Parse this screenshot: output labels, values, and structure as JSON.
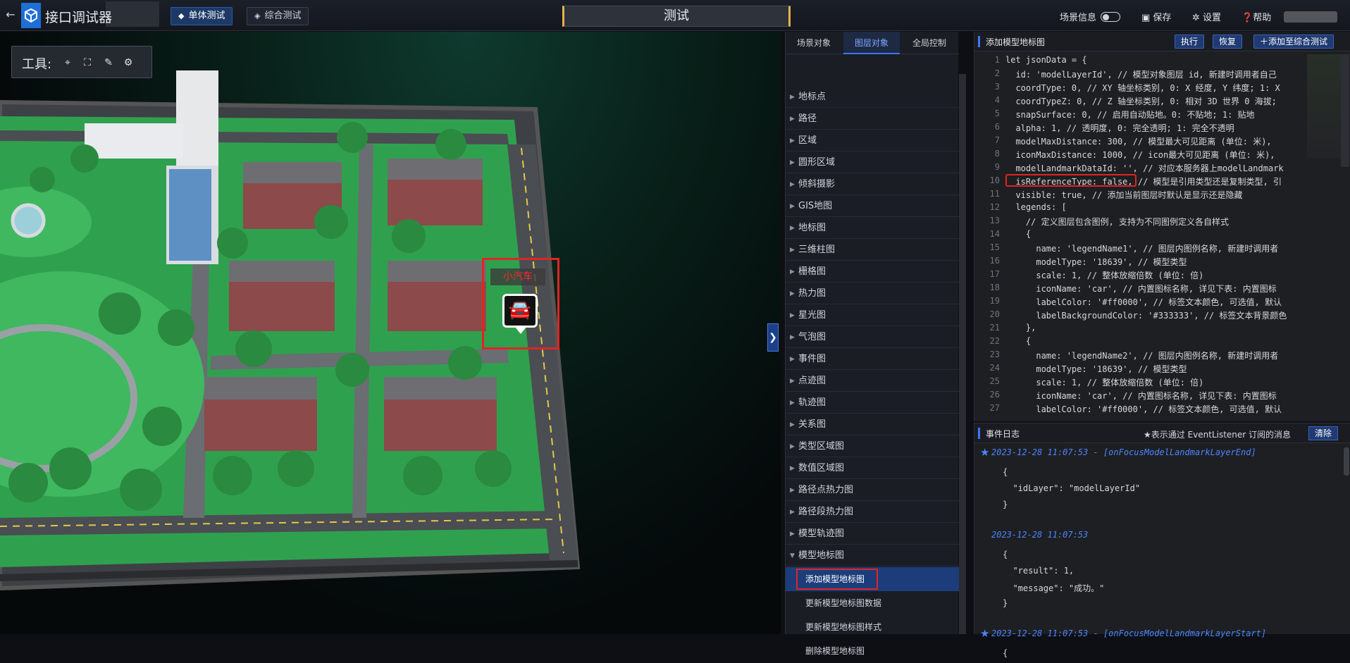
{
  "app": {
    "title": "接口调试器",
    "back_icon": "back-arrow-icon",
    "logo_icon": "cube-logo-icon"
  },
  "modes": {
    "single": "单体测试",
    "combined": "综合测试"
  },
  "center_title": "测试",
  "topright": {
    "scene_info": "场景信息",
    "save": "保存",
    "settings": "设置",
    "help": "帮助"
  },
  "toolbox": {
    "label": "工具:",
    "icons": [
      "location-pin-icon",
      "frame-select-icon",
      "pen-icon",
      "gear-multi-icon"
    ]
  },
  "scene": {
    "marker_label": "小汽车",
    "marker_icon": "car-icon"
  },
  "left_tabs": [
    "场景对象",
    "图层对象",
    "全局控制"
  ],
  "categories": [
    "地标点",
    "路径",
    "区域",
    "圆形区域",
    "倾斜摄影",
    "GIS地图",
    "地标图",
    "三维柱图",
    "栅格图",
    "热力图",
    "星光图",
    "气泡图",
    "事件图",
    "点迹图",
    "轨迹图",
    "关系图",
    "类型区域图",
    "数值区域图",
    "路径点热力图",
    "路径段热力图",
    "模型轨迹图",
    "模型地标图"
  ],
  "submenu": [
    "添加模型地标图",
    "更新模型地标图数据",
    "更新模型地标图样式",
    "删除模型地标图"
  ],
  "code_panel": {
    "title": "添加模型地标图",
    "run": "执行",
    "restore": "恢复",
    "add_to": "添加至综合测试"
  },
  "code_lines": [
    {
      "n": "1",
      "t": "let jsonData = {"
    },
    {
      "n": "2",
      "t": "  id: 'modelLayerId', // 模型对象图层 id, 新建时调用者自己"
    },
    {
      "n": "3",
      "t": "  coordType: 0, // XY 轴坐标类别, 0: X 经度, Y 纬度; 1: X"
    },
    {
      "n": "4",
      "t": "  coordTypeZ: 0, // Z 轴坐标类别, 0: 相对 3D 世界 0 海拔;"
    },
    {
      "n": "5",
      "t": "  snapSurface: 0, // 启用自动贴地。0: 不贴地; 1: 贴地"
    },
    {
      "n": "6",
      "t": "  alpha: 1, // 透明度, 0: 完全透明; 1: 完全不透明"
    },
    {
      "n": "7",
      "t": "  modelMaxDistance: 300, // 模型最大可见距离 (单位: 米),"
    },
    {
      "n": "8",
      "t": "  iconMaxDistance: 1000, // icon最大可见距离 (单位: 米),"
    },
    {
      "n": "9",
      "t": "  modelLandmarkDataId: '', // 对应本服务器上modelLandmark"
    },
    {
      "n": "10",
      "t": "  isReferenceType: false, // 模型是引用类型还是复制类型, 引"
    },
    {
      "n": "11",
      "t": "  visible: true, // 添加当前图层时默认是显示还是隐藏"
    },
    {
      "n": "12",
      "t": "  legends: ["
    },
    {
      "n": "13",
      "t": "    // 定义图层包含图例, 支持为不同图例定义各自样式"
    },
    {
      "n": "14",
      "t": "    {"
    },
    {
      "n": "15",
      "t": "      name: 'legendName1', // 图层内图例名称, 新建时调用者"
    },
    {
      "n": "16",
      "t": "      modelType: '18639', // 模型类型"
    },
    {
      "n": "17",
      "t": "      scale: 1, // 整体放缩倍数 (单位: 倍)"
    },
    {
      "n": "18",
      "t": "      iconName: 'car', // 内置图标名称, 详见下表: 内置图标"
    },
    {
      "n": "19",
      "t": "      labelColor: '#ff0000', // 标签文本颜色, 可选值, 默认"
    },
    {
      "n": "20",
      "t": "      labelBackgroundColor: '#333333', // 标签文本背景颜色"
    },
    {
      "n": "21",
      "t": "    },"
    },
    {
      "n": "22",
      "t": "    {"
    },
    {
      "n": "23",
      "t": "      name: 'legendName2', // 图层内图例名称, 新建时调用者"
    },
    {
      "n": "24",
      "t": "      modelType: '18639', // 模型类型"
    },
    {
      "n": "25",
      "t": "      scale: 1, // 整体放缩倍数 (单位: 倍)"
    },
    {
      "n": "26",
      "t": "      iconName: 'car', // 内置图标名称, 详见下表: 内置图标"
    },
    {
      "n": "27",
      "t": "      labelColor: '#ff0000', // 标签文本颜色, 可选值, 默认"
    }
  ],
  "log_panel": {
    "title": "事件日志",
    "hint": "★表示通过 EventListener 订阅的消息",
    "clear": "清除"
  },
  "log_entries": [
    {
      "star": true,
      "header": "2023-12-28 11:07:53 - [onFocusModelLandmarkLayerEnd]",
      "lines": [
        "{",
        "  \"idLayer\": \"modelLayerId\"",
        "}"
      ]
    },
    {
      "star": false,
      "header": "2023-12-28 11:07:53",
      "lines": [
        "{",
        "  \"result\": 1,",
        "  \"message\": \"成功。\"",
        "}"
      ]
    },
    {
      "star": true,
      "header": "2023-12-28 11:07:53 - [onFocusModelLandmarkLayerStart]",
      "lines": [
        "{"
      ]
    }
  ],
  "colors": {
    "accent": "#3b78ff",
    "highlight": "#e02424",
    "active_bg": "#1c3d7a"
  }
}
